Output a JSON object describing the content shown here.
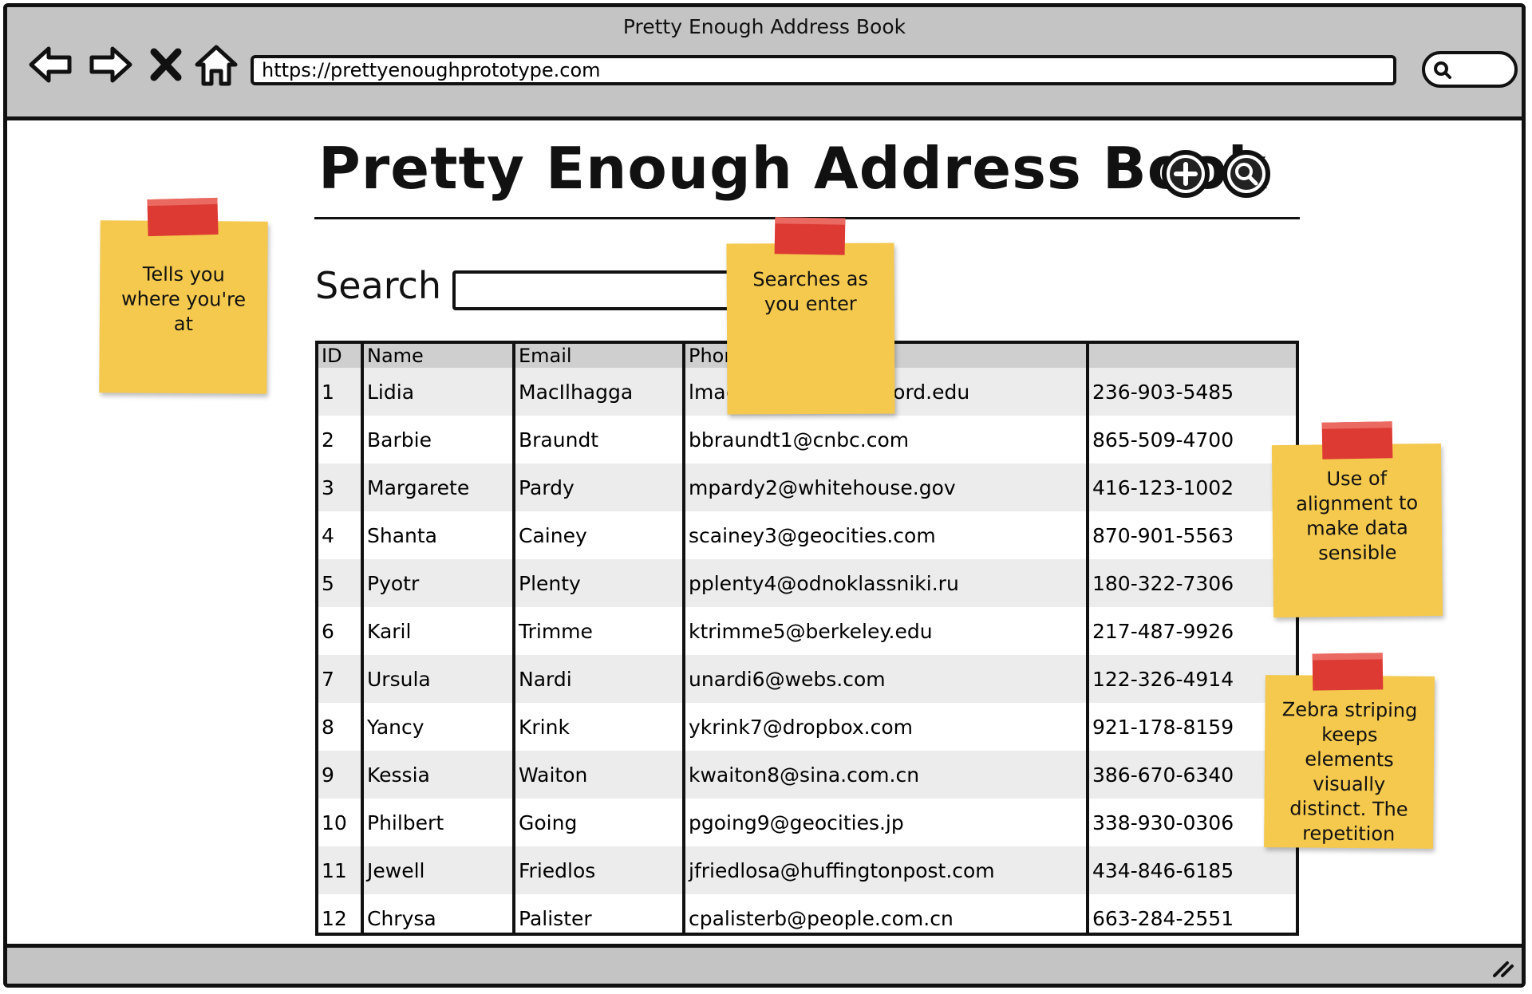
{
  "window": {
    "title": "Pretty Enough Address Book",
    "url": "https://prettyenoughprototype.com"
  },
  "toolbar": {
    "back_icon": "back-arrow-icon",
    "forward_icon": "forward-arrow-icon",
    "stop_icon": "close-icon",
    "home_icon": "home-icon",
    "search_icon": "search-icon"
  },
  "page": {
    "title": "Pretty Enough Address Book",
    "add_icon": "add-icon",
    "search_icon": "search-icon",
    "search_label": "Search",
    "search_value": ""
  },
  "table": {
    "headers": [
      "ID",
      "Name",
      "Email",
      "Phone",
      ""
    ],
    "rows": [
      [
        "1",
        "Lidia",
        "MacIlhagga",
        "lmacilhagga0@stanford.edu",
        "236-903-5485"
      ],
      [
        "2",
        "Barbie",
        "Braundt",
        "bbraundt1@cnbc.com",
        "865-509-4700"
      ],
      [
        "3",
        "Margarete",
        "Pardy",
        "mpardy2@whitehouse.gov",
        "416-123-1002"
      ],
      [
        "4",
        "Shanta",
        "Cainey",
        "scainey3@geocities.com",
        "870-901-5563"
      ],
      [
        "5",
        "Pyotr",
        "Plenty",
        "pplenty4@odnoklassniki.ru",
        "180-322-7306"
      ],
      [
        "6",
        "Karil",
        "Trimme",
        "ktrimme5@berkeley.edu",
        "217-487-9926"
      ],
      [
        "7",
        "Ursula",
        "Nardi",
        "unardi6@webs.com",
        "122-326-4914"
      ],
      [
        "8",
        "Yancy",
        "Krink",
        "ykrink7@dropbox.com",
        "921-178-8159"
      ],
      [
        "9",
        "Kessia",
        "Waiton",
        "kwaiton8@sina.com.cn",
        "386-670-6340"
      ],
      [
        "10",
        "Philbert",
        "Going",
        "pgoing9@geocities.jp",
        "338-930-0306"
      ],
      [
        "11",
        "Jewell",
        "Friedlos",
        "jfriedlosa@huffingtonpost.com",
        "434-846-6185"
      ],
      [
        "12",
        "Chrysa",
        "Palister",
        "cpalisterb@people.com.cn",
        "663-284-2551"
      ]
    ]
  },
  "notes": {
    "location": "Tells you where you're at",
    "search": "Searches as you enter",
    "alignment": "Use of alignment to make data sensible",
    "zebra": "Zebra striping keeps elements visually distinct.  The repetition"
  },
  "colors": {
    "chrome": "#c4c4c4",
    "sticky": "#f4c94d",
    "tape": "#dc3a33",
    "stripe": "#ececec",
    "header": "#cfcfcf"
  }
}
